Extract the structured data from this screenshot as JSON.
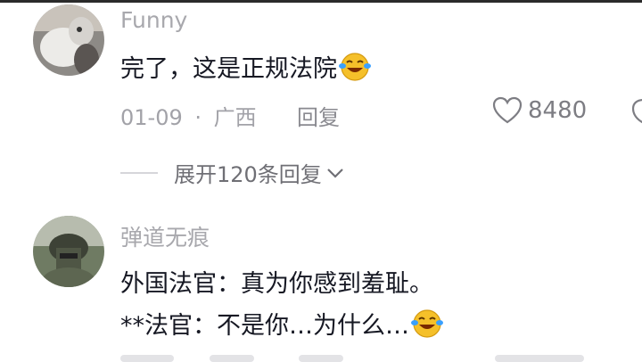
{
  "comments": [
    {
      "username": "Funny",
      "text": "完了，这是正规法院",
      "date": "01-09",
      "separator": "·",
      "location": "广西",
      "reply_label": "回复",
      "like_count": "8480",
      "expand_label": "展开120条回复",
      "avatar_icon": "cat-photo-avatar"
    },
    {
      "username": "弹道无痕",
      "line1": "外国法官：真为你感到羞耻。",
      "line2": "**法官：不是你…为什么…",
      "avatar_icon": "soldier-helmet-avatar"
    }
  ],
  "colors": {
    "username": "#a8a8ad",
    "text": "#161823",
    "meta": "#a2a2a8",
    "emoji": "#f5c02a"
  }
}
